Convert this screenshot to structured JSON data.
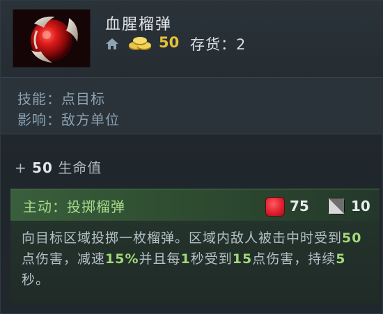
{
  "item": {
    "name": "血腥榴弹",
    "cost": "50",
    "stock_label": "存货：",
    "stock_value": "2",
    "icon": "blood-grenade-icon",
    "home_icon": "home-icon",
    "gold_icon": "gold-coins-icon"
  },
  "info": {
    "ability_line": "技能：点目标",
    "affects_line": "影响：敌方单位"
  },
  "stat": {
    "prefix": "+",
    "value": "50",
    "label": "生命值"
  },
  "active": {
    "title": "主动：投掷榴弹",
    "mana_cost": "75",
    "cooldown": "10",
    "desc_1": "向目标区域投掷一枚榴弹。区域内敌人被击中时受到",
    "dmg": "50",
    "desc_2": "点伤害，减速",
    "slow": "15%",
    "desc_3": "并且每",
    "tick": "1",
    "desc_4": "秒受到",
    "dot": "15",
    "desc_5": "点伤害，持续",
    "duration": "5",
    "desc_6": "秒。"
  },
  "colors": {
    "gold": "#e6c03a",
    "highlight": "#a3d978",
    "ability_title": "#a8df8f",
    "mana": "#e0202e",
    "info_text": "#8ea3b5"
  }
}
